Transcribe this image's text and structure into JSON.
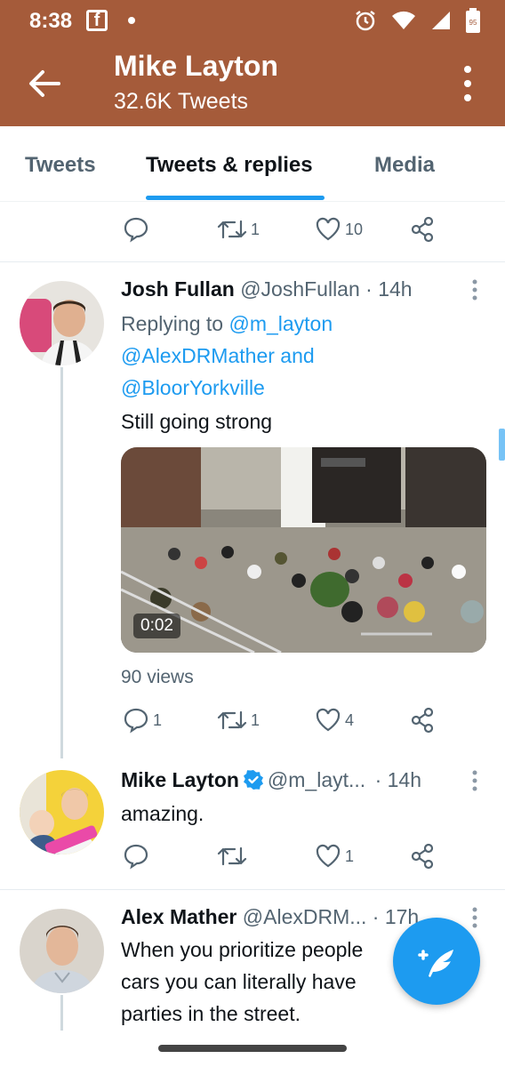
{
  "status_bar": {
    "time": "8:38",
    "notification_icon": "facebook-icon",
    "battery": "95"
  },
  "header": {
    "name": "Mike Layton",
    "tweet_count": "32.6K Tweets",
    "accent_color": "#a55b3a"
  },
  "tabs": [
    {
      "label": "Tweets",
      "active": false
    },
    {
      "label": "Tweets & replies",
      "active": true
    },
    {
      "label": "Media",
      "active": false
    }
  ],
  "top_actions": {
    "retweets": "1",
    "likes": "10"
  },
  "tweets": [
    {
      "name": "Josh Fullan",
      "handle": "@JoshFullan",
      "time": "· 14h",
      "reply_prefix": "Replying to",
      "reply_line1_handle": "@m_layton",
      "reply_line2_handle": "@AlexDRMather",
      "reply_and": "and",
      "reply_line3_handle": "@BloorYorkville",
      "text": "Still going strong",
      "video_duration": "0:02",
      "views": "90 views",
      "replies": "1",
      "retweets": "1",
      "likes": "4"
    },
    {
      "name": "Mike Layton",
      "handle": "@m_layt...",
      "time": "· 14h",
      "text": "amazing.",
      "replies": "",
      "retweets": "",
      "likes": "1"
    },
    {
      "name": "Alex Mather",
      "handle": "@AlexDRM...",
      "time": "· 17h",
      "text_line1": "When you prioritize people",
      "text_line2": "cars you can literally have",
      "text_line3": "parties in the street."
    }
  ],
  "colors": {
    "link": "#1d9bf0",
    "secondary": "#536471"
  }
}
